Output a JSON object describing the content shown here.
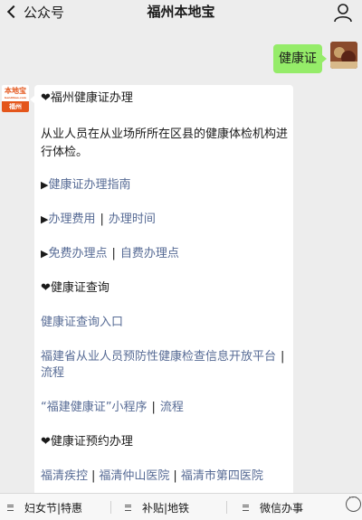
{
  "nav": {
    "back_label": "公众号",
    "title": "福州本地宝"
  },
  "user_message": "健康证",
  "bot_avatar": {
    "top_text": "本地宝",
    "tiny_text": "bendibao.com",
    "bottom_text": "福州"
  },
  "reply": {
    "heading1": "❤福州健康证办理",
    "body_line1": "从业人员在从业场所所在区县的健康体检机构进",
    "body_line2": "行体检。",
    "row1": {
      "marker": "▶",
      "link1": "健康证办理指南"
    },
    "row2": {
      "marker": "▶",
      "link1": "办理费用",
      "sep": "|",
      "link2": "办理时间"
    },
    "row3": {
      "marker": "▶",
      "link1": "免费办理点",
      "sep": "|",
      "link2": "自费办理点"
    },
    "heading2": "❤健康证查询",
    "query_link": "健康证查询入口",
    "platform_link": "福建省从业人员预防性健康检查信息开放平台",
    "platform_sep": "|",
    "platform_flow": "流程",
    "mini_link": "“福建健康证”小程序",
    "mini_sep": "|",
    "mini_flow": "流程",
    "heading3": "❤健康证预约办理",
    "appoint1": "福清疾控",
    "appoint2": "福清仲山医院",
    "appoint3": "福清市第四医院",
    "appoint_sep": "|"
  },
  "menu": {
    "item1": "妇女节|特惠",
    "item2": "补贴|地铁",
    "item3": "微信办事"
  }
}
